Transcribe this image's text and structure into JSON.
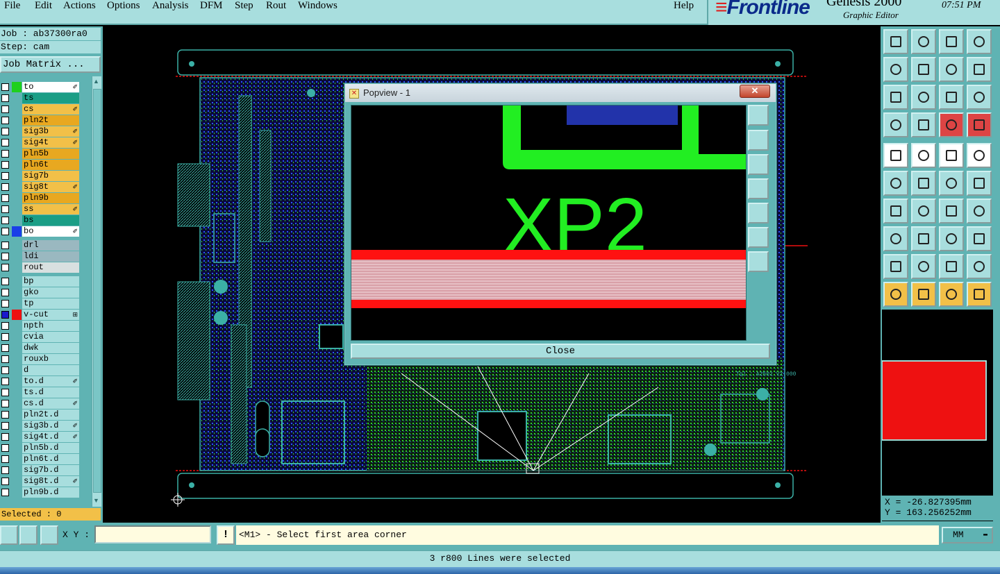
{
  "menu": {
    "items": [
      "File",
      "Edit",
      "Actions",
      "Options",
      "Analysis",
      "DFM",
      "Step",
      "Rout",
      "Windows"
    ],
    "help": "Help"
  },
  "brand": {
    "logo": "Frontline",
    "product": "Genesis 2000",
    "subtitle": "Graphic Editor",
    "clock": "07:51 PM"
  },
  "job": {
    "job_line": "Job : ab37300ra0",
    "step_line": "Step: cam",
    "matrix_button": "Job Matrix ...",
    "selected": "Selected : 0"
  },
  "layers": [
    {
      "name": "to",
      "color": "#ffffff",
      "swatch": "#1fd01f",
      "mark": "✐",
      "checked": false
    },
    {
      "name": "ts",
      "color": "#1b9e86",
      "swatch": "",
      "mark": "",
      "checked": false
    },
    {
      "name": "cs",
      "color": "#f2c048",
      "swatch": "",
      "mark": "✐",
      "checked": false
    },
    {
      "name": "pln2t",
      "color": "#e8a820",
      "swatch": "",
      "mark": "",
      "checked": false
    },
    {
      "name": "sig3b",
      "color": "#f2c048",
      "swatch": "",
      "mark": "✐",
      "checked": false
    },
    {
      "name": "sig4t",
      "color": "#f2c048",
      "swatch": "",
      "mark": "✐",
      "checked": false
    },
    {
      "name": "pln5b",
      "color": "#e8a820",
      "swatch": "",
      "mark": "",
      "checked": false
    },
    {
      "name": "pln6t",
      "color": "#e8a820",
      "swatch": "",
      "mark": "",
      "checked": false
    },
    {
      "name": "sig7b",
      "color": "#f2c048",
      "swatch": "",
      "mark": "",
      "checked": false
    },
    {
      "name": "sig8t",
      "color": "#f2c048",
      "swatch": "",
      "mark": "✐",
      "checked": false
    },
    {
      "name": "pln9b",
      "color": "#e8a820",
      "swatch": "",
      "mark": "",
      "checked": false
    },
    {
      "name": "ss",
      "color": "#f2c048",
      "swatch": "",
      "mark": "✐",
      "checked": false
    },
    {
      "name": "bs",
      "color": "#1b9e86",
      "swatch": "",
      "mark": "",
      "checked": false
    },
    {
      "name": "bo",
      "color": "#ffffff",
      "swatch": "#1a3ee8",
      "mark": "✐",
      "checked": false
    },
    {
      "name": "drl",
      "color": "#9ab8c0",
      "swatch": "",
      "mark": "",
      "checked": false
    },
    {
      "name": "ldi",
      "color": "#9ab8c0",
      "swatch": "",
      "mark": "",
      "checked": false
    },
    {
      "name": "rout",
      "color": "#d8e0e0",
      "swatch": "",
      "mark": "",
      "checked": false
    },
    {
      "name": "bp",
      "color": "#a8dede",
      "swatch": "",
      "mark": "",
      "checked": false
    },
    {
      "name": "gko",
      "color": "#a8dede",
      "swatch": "",
      "mark": "",
      "checked": false
    },
    {
      "name": "tp",
      "color": "#a8dede",
      "swatch": "",
      "mark": "",
      "checked": false
    },
    {
      "name": "v-cut",
      "color": "#a8dede",
      "swatch": "#ee1111",
      "mark": "⊞",
      "checked": true
    },
    {
      "name": "npth",
      "color": "#a8dede",
      "swatch": "",
      "mark": "",
      "checked": false
    },
    {
      "name": "cvia",
      "color": "#a8dede",
      "swatch": "",
      "mark": "",
      "checked": false
    },
    {
      "name": "dwk",
      "color": "#a8dede",
      "swatch": "",
      "mark": "",
      "checked": false
    },
    {
      "name": "rouxb",
      "color": "#a8dede",
      "swatch": "",
      "mark": "",
      "checked": false
    },
    {
      "name": "d",
      "color": "#a8dede",
      "swatch": "",
      "mark": "",
      "checked": false
    },
    {
      "name": "to.d",
      "color": "#a8dede",
      "swatch": "",
      "mark": "✐",
      "checked": false
    },
    {
      "name": "ts.d",
      "color": "#a8dede",
      "swatch": "",
      "mark": "",
      "checked": false
    },
    {
      "name": "cs.d",
      "color": "#a8dede",
      "swatch": "",
      "mark": "✐",
      "checked": false
    },
    {
      "name": "pln2t.d",
      "color": "#a8dede",
      "swatch": "",
      "mark": "",
      "checked": false
    },
    {
      "name": "sig3b.d",
      "color": "#a8dede",
      "swatch": "",
      "mark": "✐",
      "checked": false
    },
    {
      "name": "sig4t.d",
      "color": "#a8dede",
      "swatch": "",
      "mark": "✐",
      "checked": false
    },
    {
      "name": "pln5b.d",
      "color": "#a8dede",
      "swatch": "",
      "mark": "",
      "checked": false
    },
    {
      "name": "pln6t.d",
      "color": "#a8dede",
      "swatch": "",
      "mark": "",
      "checked": false
    },
    {
      "name": "sig7b.d",
      "color": "#a8dede",
      "swatch": "",
      "mark": "",
      "checked": false
    },
    {
      "name": "sig8t.d",
      "color": "#a8dede",
      "swatch": "",
      "mark": "✐",
      "checked": false
    },
    {
      "name": "pln9b.d",
      "color": "#a8dede",
      "swatch": "",
      "mark": "",
      "checked": false
    }
  ],
  "popview": {
    "title": "Popview - 1",
    "close_x": "✕",
    "view_text": "XP2",
    "close_button": "Close"
  },
  "board": {
    "silk_label": "Tql : A2502 V2.000"
  },
  "coords": {
    "x": "X = -26.827395mm",
    "y": "Y = 163.256252mm"
  },
  "bottom": {
    "xy_label": "X Y :",
    "xy_value": "",
    "message": "<M1> - Select first area corner",
    "unit": "MM"
  },
  "status": "3 r800 Lines were selected",
  "colors": {
    "panel": "#5fb3b3",
    "panel_light": "#a8dede",
    "highlight": "#f2c048",
    "silk": "#1fd01f",
    "copper_blue": "#1a3ee8",
    "vcut": "#ee1111"
  }
}
